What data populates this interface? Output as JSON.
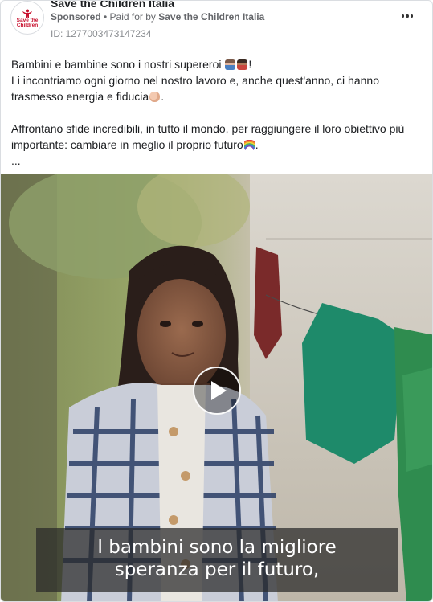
{
  "post": {
    "page_name": "Save the Children Italia",
    "sponsored_label": "Sponsored",
    "separator": " • ",
    "paid_for_prefix": "Paid for by ",
    "advertiser": "Save the Children Italia",
    "ad_id": "ID: 1277003473147234",
    "logo_text_line1": "Save the",
    "logo_text_line2": "Children"
  },
  "body": {
    "line1_text": "Bambini e bambine sono i nostri supereroi",
    "line1_end": "!",
    "line2": "Li incontriamo ogni giorno nel nostro lavoro e, anche quest'anno, ci hanno",
    "line3_text": "trasmesso energia e fiducia",
    "line3_end": ".",
    "para2_line1": "Affrontano sfide incredibili, in tutto il mondo, per raggiungere il loro obiettivo più",
    "para2_line2_text": "importante: cambiare in meglio il proprio futuro",
    "para2_line2_end": ".",
    "ellipsis": "..."
  },
  "emojis": {
    "superhero_woman": "superhero-woman-icon",
    "superhero_man": "superhero-man-icon",
    "flexed_biceps": "flexed-biceps-icon",
    "rainbow": "rainbow-icon"
  },
  "video": {
    "subtitle_line1": "I bambini sono la migliore",
    "subtitle_line2": "speranza per il futuro,"
  },
  "colors": {
    "brand_red": "#c8102e",
    "text_primary": "#1c1e21",
    "text_secondary": "#65676b"
  }
}
